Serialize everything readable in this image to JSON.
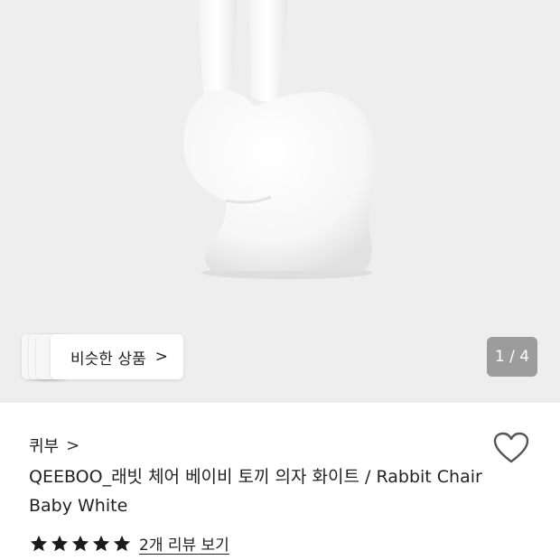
{
  "gallery": {
    "similar_label": "비슷한 상품",
    "similar_chevron": ">",
    "pager": "1 / 4"
  },
  "product": {
    "brand": "퀴부",
    "brand_chevron": ">",
    "title": "QEEBOO_래빗 체어 베이비 토끼 의자 화이트 / Rabbit Chair Baby White",
    "rating": 5,
    "review_link": "2개 리뷰 보기"
  },
  "colors": {
    "hero_bg": "#eeeeee",
    "star": "#1a1a1a",
    "pager_bg": "#9c9c9c"
  },
  "icons": {
    "wishlist": "heart-outline-icon",
    "star": "star-filled-icon"
  }
}
